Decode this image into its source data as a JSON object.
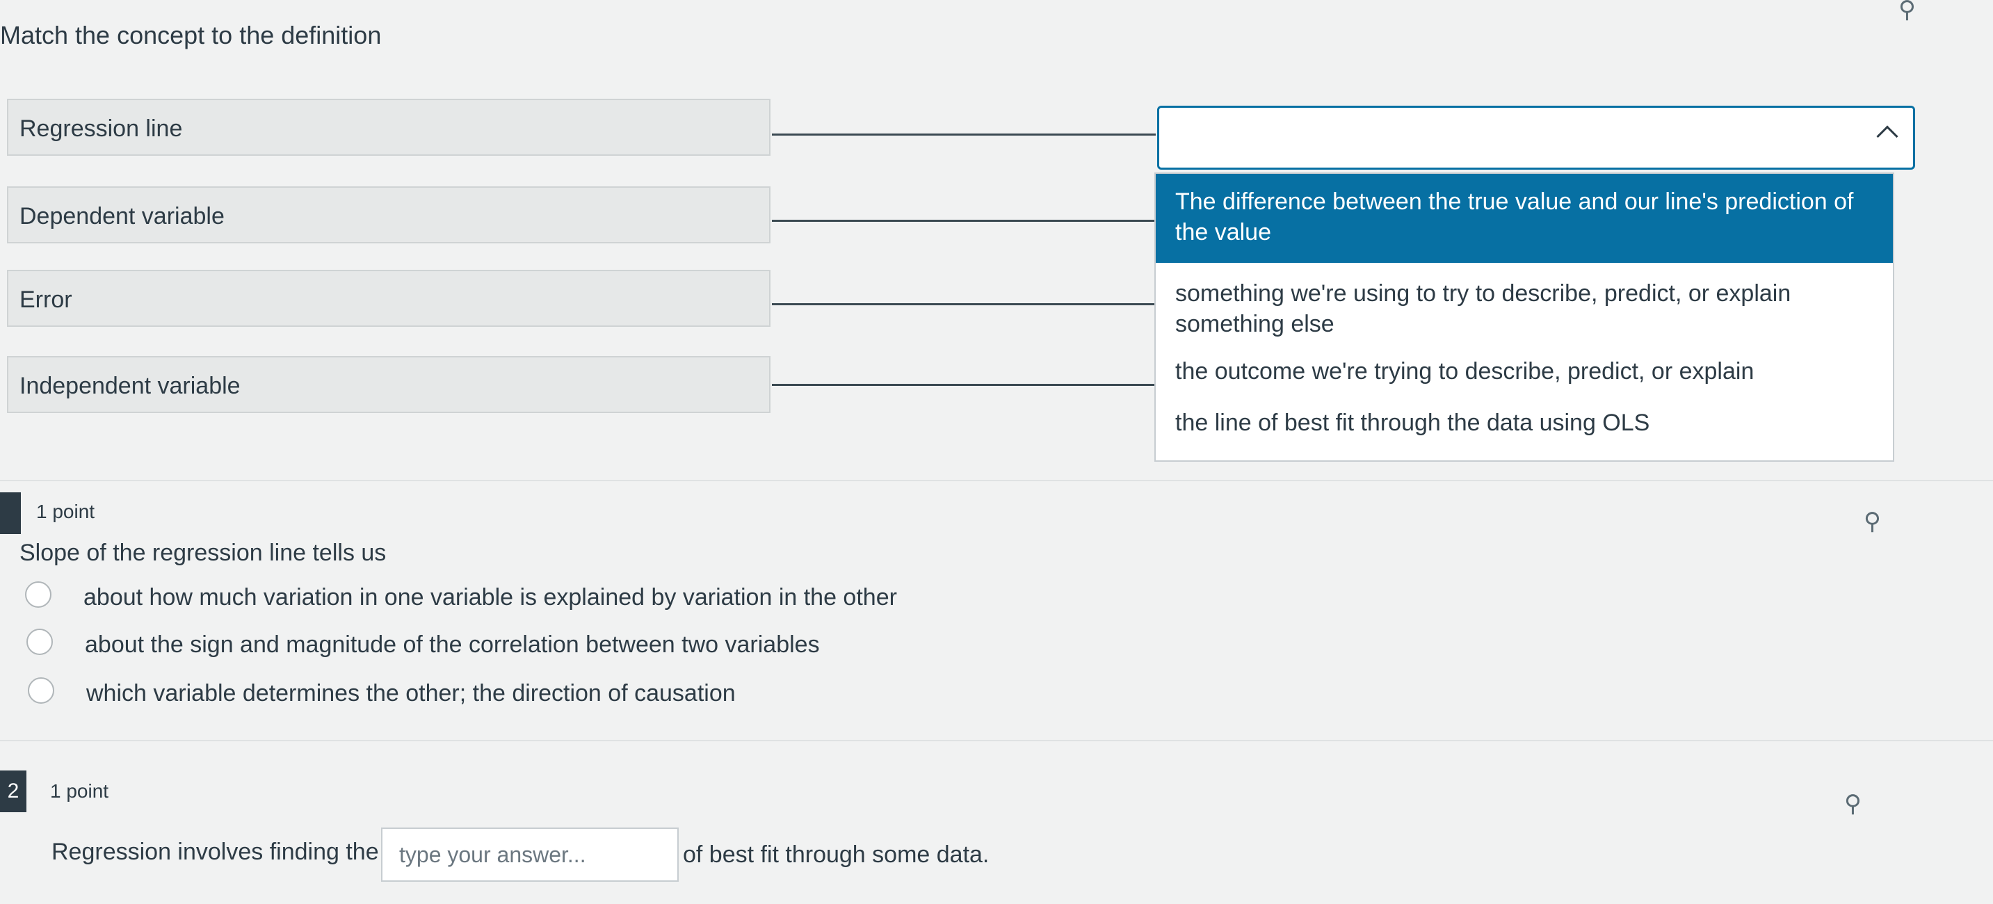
{
  "question1": {
    "prompt": "Match the concept to the definition",
    "concepts": [
      "Regression line",
      "Dependent variable",
      "Error",
      "Independent variable"
    ],
    "dropdown": {
      "selected_value": "",
      "options": [
        "The difference between the true value and our line's prediction of the value",
        "something we're using to try to describe, predict, or explain something else",
        "the outcome we're trying to describe, predict, or explain",
        "the line of best fit through the data using OLS"
      ],
      "highlighted_index": 0
    },
    "pin_icon": "pin-icon"
  },
  "question2": {
    "points": "1 point",
    "prompt": "Slope of the regression line tells us",
    "choices": [
      "about how much variation in one variable is explained by variation in the other",
      "about the sign and magnitude of the correlation between two variables",
      "which variable determines the other; the direction of causation"
    ],
    "pin_icon": "pin-icon"
  },
  "question3": {
    "number": "2",
    "points": "1 point",
    "text_before": "Regression involves finding the",
    "input_placeholder": "type your answer...",
    "text_after": "of best fit through some data.",
    "pin_icon": "pin-icon"
  },
  "colors": {
    "accent": "#0770a3",
    "text": "#2d3b45",
    "background": "#f1f2f2"
  }
}
